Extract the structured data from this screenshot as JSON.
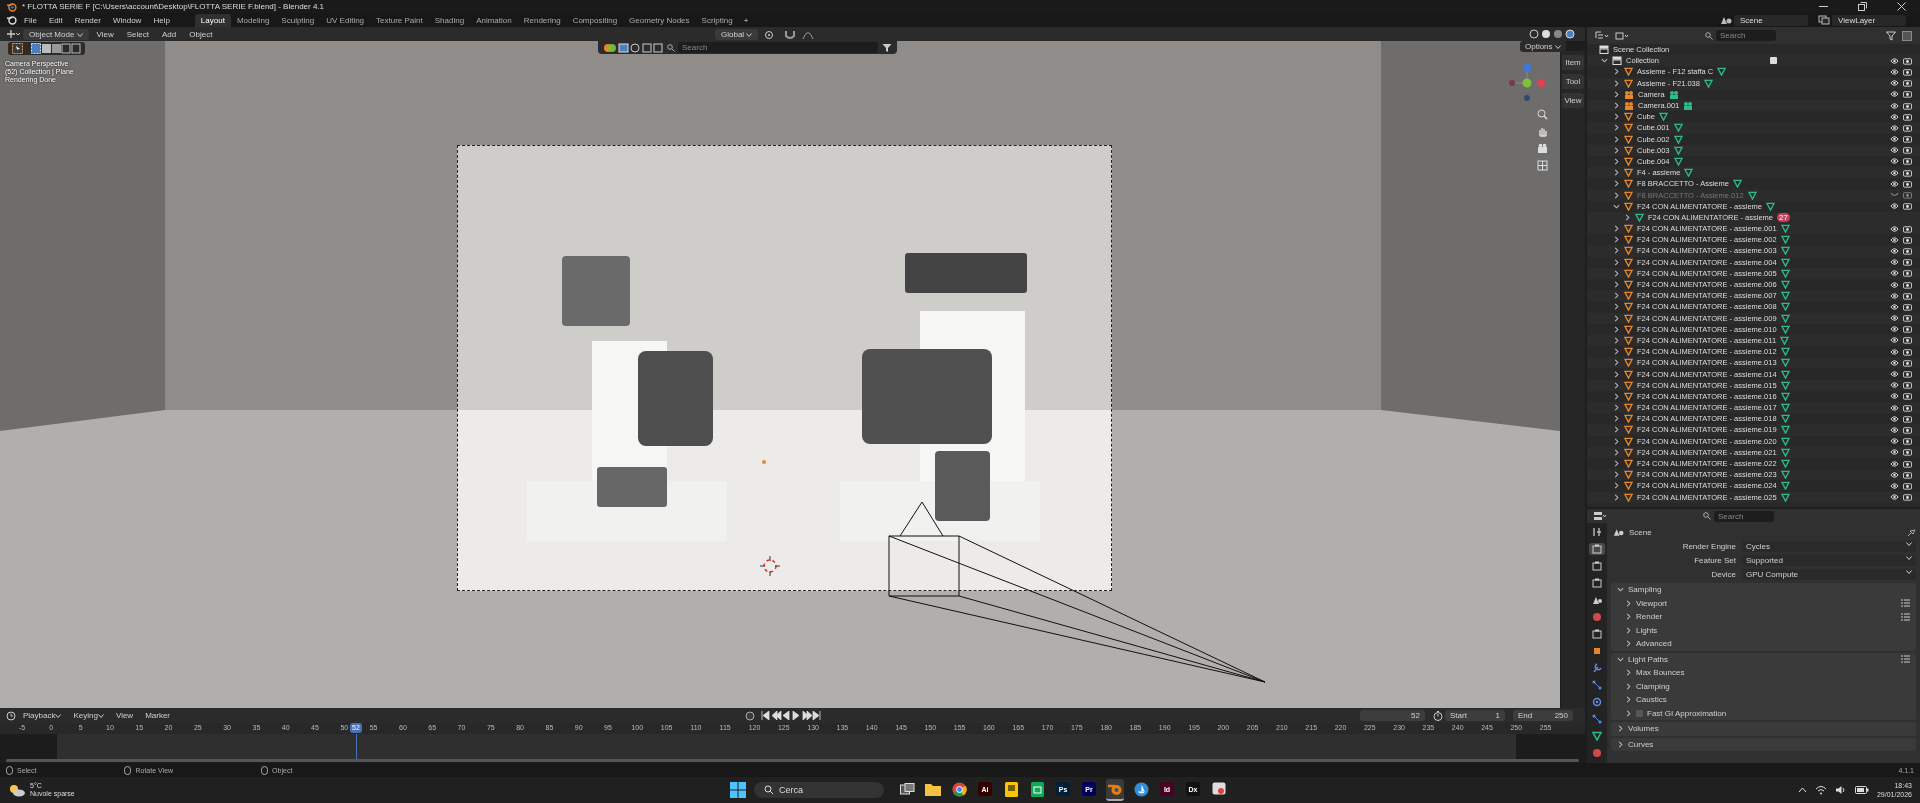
{
  "window": {
    "title": "* FLOTTA SERIE F [C:\\Users\\account\\Desktop\\FLOTTA SERIE F.blend] - Blender 4.1"
  },
  "menu": [
    "File",
    "Edit",
    "Render",
    "Window",
    "Help"
  ],
  "workspaces": [
    {
      "label": "Layout",
      "selected": true
    },
    {
      "label": "Modeling",
      "selected": false
    },
    {
      "label": "Sculpting",
      "selected": false
    },
    {
      "label": "UV Editing",
      "selected": false
    },
    {
      "label": "Texture Paint",
      "selected": false
    },
    {
      "label": "Shading",
      "selected": false
    },
    {
      "label": "Animation",
      "selected": false
    },
    {
      "label": "Rendering",
      "selected": false
    },
    {
      "label": "Compositing",
      "selected": false
    },
    {
      "label": "Geometry Nodes",
      "selected": false
    },
    {
      "label": "Scripting",
      "selected": false
    }
  ],
  "add_workspace": "+",
  "scene_field": "Scene",
  "view_layer_field": "ViewLayer",
  "viewport": {
    "mode": "Object Mode",
    "menus": [
      "View",
      "Select",
      "Add",
      "Object"
    ],
    "orientation": "Global",
    "search": {
      "placeholder": "Search"
    },
    "options": "Options",
    "overlay_text": [
      "Camera Perspective",
      "(52) Collection | Plane",
      "Rendering Done"
    ],
    "sidebar_tabs": [
      {
        "label": "Item",
        "selected": false
      },
      {
        "label": "Tool",
        "selected": false
      },
      {
        "label": "View",
        "selected": false
      }
    ]
  },
  "outliner": {
    "search": {
      "placeholder": "Search"
    },
    "root": "Scene Collection",
    "collection": {
      "name": "Collection",
      "expanded": true,
      "checked": true
    },
    "items": [
      {
        "name": "Assieme - F12 staffa C",
        "kind": "mesh",
        "expanded": false,
        "disabled": false
      },
      {
        "name": "Assieme - F21.038",
        "kind": "mesh",
        "expanded": false,
        "disabled": false
      },
      {
        "name": "Camera",
        "kind": "camera",
        "expanded": false,
        "disabled": false
      },
      {
        "name": "Camera.001",
        "kind": "camera",
        "expanded": false,
        "disabled": false
      },
      {
        "name": "Cube",
        "kind": "mesh",
        "expanded": false,
        "disabled": false
      },
      {
        "name": "Cube.001",
        "kind": "mesh",
        "expanded": false,
        "disabled": false
      },
      {
        "name": "Cube.002",
        "kind": "mesh",
        "expanded": false,
        "disabled": false
      },
      {
        "name": "Cube.003",
        "kind": "mesh",
        "expanded": false,
        "disabled": false
      },
      {
        "name": "Cube.004",
        "kind": "mesh",
        "expanded": false,
        "disabled": false
      },
      {
        "name": "F4 - assieme",
        "kind": "mesh",
        "expanded": false,
        "disabled": false
      },
      {
        "name": "F8 BRACCETTO - Assieme",
        "kind": "mesh",
        "expanded": false,
        "disabled": false
      },
      {
        "name": "F8 BRACCETTO - Assieme.012",
        "kind": "mesh",
        "expanded": false,
        "disabled": true
      },
      {
        "name": "F24 CON ALIMENTATORE - assieme",
        "kind": "mesh",
        "expanded": true,
        "disabled": false,
        "children": [
          {
            "name": "F24 CON ALIMENTATORE - assieme",
            "kind": "mesh_data",
            "expanded": false,
            "disabled": false,
            "badge": "27"
          }
        ]
      },
      {
        "name": "F24 CON ALIMENTATORE - assieme.001",
        "kind": "mesh",
        "expanded": false,
        "disabled": false
      },
      {
        "name": "F24 CON ALIMENTATORE - assieme.002",
        "kind": "mesh",
        "expanded": false,
        "disabled": false
      },
      {
        "name": "F24 CON ALIMENTATORE - assieme.003",
        "kind": "mesh",
        "expanded": false,
        "disabled": false
      },
      {
        "name": "F24 CON ALIMENTATORE - assieme.004",
        "kind": "mesh",
        "expanded": false,
        "disabled": false
      },
      {
        "name": "F24 CON ALIMENTATORE - assieme.005",
        "kind": "mesh",
        "expanded": false,
        "disabled": false
      },
      {
        "name": "F24 CON ALIMENTATORE - assieme.006",
        "kind": "mesh",
        "expanded": false,
        "disabled": false
      },
      {
        "name": "F24 CON ALIMENTATORE - assieme.007",
        "kind": "mesh",
        "expanded": false,
        "disabled": false
      },
      {
        "name": "F24 CON ALIMENTATORE - assieme.008",
        "kind": "mesh",
        "expanded": false,
        "disabled": false
      },
      {
        "name": "F24 CON ALIMENTATORE - assieme.009",
        "kind": "mesh",
        "expanded": false,
        "disabled": false
      },
      {
        "name": "F24 CON ALIMENTATORE - assieme.010",
        "kind": "mesh",
        "expanded": false,
        "disabled": false
      },
      {
        "name": "F24 CON ALIMENTATORE - assieme.011",
        "kind": "mesh",
        "expanded": false,
        "disabled": false
      },
      {
        "name": "F24 CON ALIMENTATORE - assieme.012",
        "kind": "mesh",
        "expanded": false,
        "disabled": false
      },
      {
        "name": "F24 CON ALIMENTATORE - assieme.013",
        "kind": "mesh",
        "expanded": false,
        "disabled": false
      },
      {
        "name": "F24 CON ALIMENTATORE - assieme.014",
        "kind": "mesh",
        "expanded": false,
        "disabled": false
      },
      {
        "name": "F24 CON ALIMENTATORE - assieme.015",
        "kind": "mesh",
        "expanded": false,
        "disabled": false
      },
      {
        "name": "F24 CON ALIMENTATORE - assieme.016",
        "kind": "mesh",
        "expanded": false,
        "disabled": false
      },
      {
        "name": "F24 CON ALIMENTATORE - assieme.017",
        "kind": "mesh",
        "expanded": false,
        "disabled": false
      },
      {
        "name": "F24 CON ALIMENTATORE - assieme.018",
        "kind": "mesh",
        "expanded": false,
        "disabled": false
      },
      {
        "name": "F24 CON ALIMENTATORE - assieme.019",
        "kind": "mesh",
        "expanded": false,
        "disabled": false
      },
      {
        "name": "F24 CON ALIMENTATORE - assieme.020",
        "kind": "mesh",
        "expanded": false,
        "disabled": false
      },
      {
        "name": "F24 CON ALIMENTATORE - assieme.021",
        "kind": "mesh",
        "expanded": false,
        "disabled": false
      },
      {
        "name": "F24 CON ALIMENTATORE - assieme.022",
        "kind": "mesh",
        "expanded": false,
        "disabled": false
      },
      {
        "name": "F24 CON ALIMENTATORE - assieme.023",
        "kind": "mesh",
        "expanded": false,
        "disabled": false
      },
      {
        "name": "F24 CON ALIMENTATORE - assieme.024",
        "kind": "mesh",
        "expanded": false,
        "disabled": false
      },
      {
        "name": "F24 CON ALIMENTATORE - assieme.025",
        "kind": "mesh",
        "expanded": false,
        "disabled": false
      }
    ]
  },
  "properties": {
    "search": {
      "placeholder": "Search"
    },
    "tabs": [
      {
        "kind": "tool",
        "selected": false
      },
      {
        "kind": "render",
        "selected": true
      },
      {
        "kind": "output",
        "selected": false
      },
      {
        "kind": "view_layer",
        "selected": false
      },
      {
        "kind": "scene",
        "selected": false
      },
      {
        "kind": "world",
        "selected": false
      },
      {
        "kind": "collection",
        "selected": false
      },
      {
        "kind": "object",
        "selected": false
      },
      {
        "kind": "modifiers",
        "selected": false
      },
      {
        "kind": "particles",
        "selected": false
      },
      {
        "kind": "physics",
        "selected": false
      },
      {
        "kind": "constraints",
        "selected": false
      },
      {
        "kind": "data",
        "selected": false
      },
      {
        "kind": "material",
        "selected": false
      }
    ],
    "context": "Scene",
    "fields": [
      {
        "label": "Render Engine",
        "value": "Cycles"
      },
      {
        "label": "Feature Set",
        "value": "Supported"
      },
      {
        "label": "Device",
        "value": "GPU Compute"
      }
    ],
    "panels": [
      {
        "title": "Sampling",
        "expanded": true,
        "presets": false,
        "subpanels": [
          {
            "title": "Viewport",
            "presets": true
          },
          {
            "title": "Render",
            "presets": true
          },
          {
            "title": "Lights",
            "presets": false
          },
          {
            "title": "Advanced",
            "presets": false
          }
        ]
      },
      {
        "title": "Light Paths",
        "expanded": true,
        "presets": true,
        "subpanels": [
          {
            "title": "Max Bounces",
            "presets": false
          },
          {
            "title": "Clamping",
            "presets": false
          },
          {
            "title": "Caustics",
            "presets": false
          },
          {
            "title": "Fast GI Approximation",
            "presets": false,
            "checkbox": {
              "checked": false
            }
          }
        ]
      },
      {
        "title": "Volumes",
        "expanded": false,
        "presets": false
      },
      {
        "title": "Curves",
        "expanded": false,
        "presets": false
      }
    ]
  },
  "timeline": {
    "menus": [
      {
        "label": "Playback",
        "dropdown": true
      },
      {
        "label": "Keying",
        "dropdown": true
      },
      {
        "label": "View",
        "dropdown": false
      },
      {
        "label": "Marker",
        "dropdown": false
      }
    ],
    "playhead": "52",
    "current_frame": "52",
    "start_label": "Start",
    "start": "1",
    "end_label": "End",
    "end": "250",
    "ruler": [
      "-5",
      "0",
      "5",
      "10",
      "15",
      "20",
      "25",
      "30",
      "35",
      "40",
      "45",
      "50",
      "55",
      "60",
      "65",
      "70",
      "75",
      "80",
      "85",
      "90",
      "95",
      "100",
      "105",
      "110",
      "115",
      "120",
      "125",
      "130",
      "135",
      "140",
      "145",
      "150",
      "155",
      "160",
      "165",
      "170",
      "175",
      "180",
      "185",
      "190",
      "195",
      "200",
      "205",
      "210",
      "215",
      "220",
      "225",
      "230",
      "235",
      "240",
      "245",
      "250",
      "255"
    ]
  },
  "status_bar": {
    "hints": [
      "Select",
      "Rotate View",
      "Object"
    ],
    "version": "4.1.1"
  },
  "taskbar": {
    "weather": {
      "temperature": "5°C",
      "condition": "Nuvole sparse"
    },
    "search": "Cerca",
    "apps": [
      {
        "kind": "task_view",
        "active": false
      },
      {
        "kind": "folder",
        "active": false
      },
      {
        "kind": "browser",
        "active": false
      },
      {
        "kind": "letter",
        "label": "Ai",
        "color": "#330000",
        "active": false
      },
      {
        "kind": "note",
        "active": false
      },
      {
        "kind": "sheet",
        "active": false
      },
      {
        "kind": "letter",
        "label": "Ps",
        "color": "#001e36",
        "active": false
      },
      {
        "kind": "letter",
        "label": "Pr",
        "color": "#00005b",
        "active": false
      },
      {
        "kind": "blender",
        "active": true
      },
      {
        "kind": "cloud",
        "active": false
      },
      {
        "kind": "letter",
        "label": "Id",
        "color": "#49021f",
        "active": false
      },
      {
        "kind": "letter",
        "label": "Dx",
        "color": "#111111",
        "active": false
      },
      {
        "kind": "snip",
        "active": false
      }
    ],
    "time": "18:43",
    "date": "29/01/2026"
  }
}
